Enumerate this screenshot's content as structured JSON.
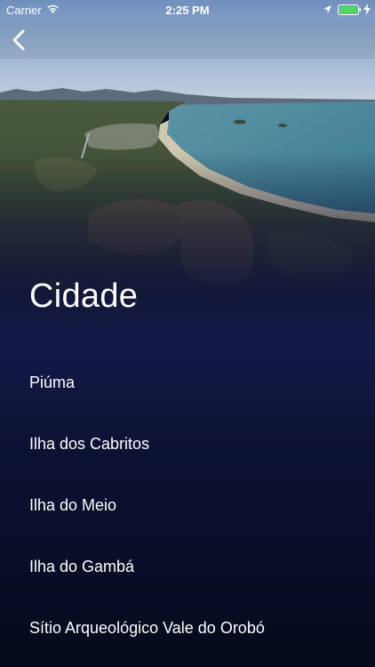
{
  "status_bar": {
    "carrier": "Carrier",
    "time": "2:25 PM",
    "icons": [
      "wifi-icon",
      "location-icon",
      "battery-icon",
      "charging-bolt-icon"
    ],
    "battery_color": "#4cd964"
  },
  "nav": {
    "back_icon": "chevron-left-icon"
  },
  "content": {
    "title": "Cidade",
    "items": [
      {
        "label": "Piúma"
      },
      {
        "label": "Ilha dos Cabritos"
      },
      {
        "label": "Ilha do Meio"
      },
      {
        "label": "Ilha do Gambá"
      },
      {
        "label": "Sítio Arqueológico Vale do Orobó"
      }
    ]
  },
  "colors": {
    "background_top": "#141a48",
    "background_bottom": "#060a1c",
    "text": "#ffffff"
  }
}
